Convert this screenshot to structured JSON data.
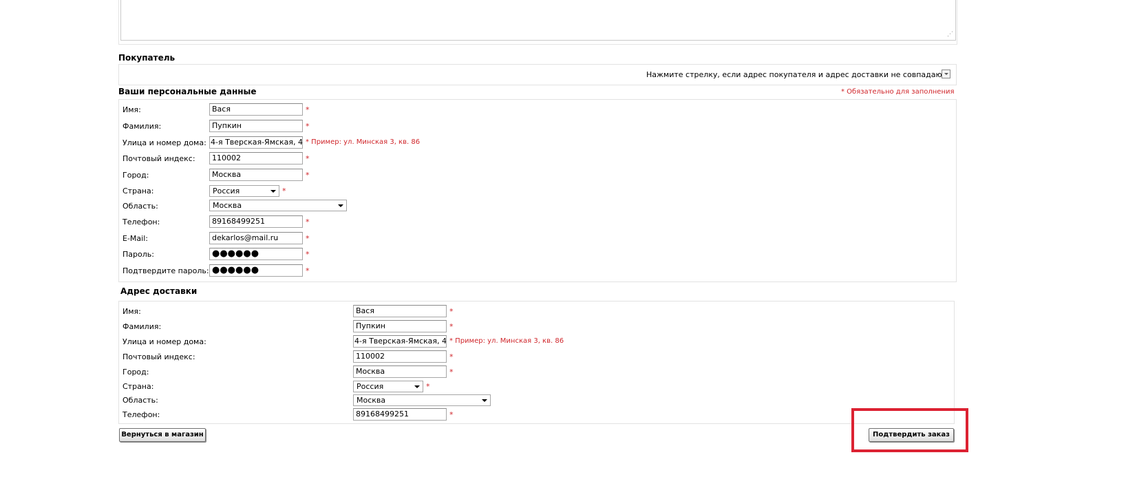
{
  "buyer": {
    "title": "Покупатель",
    "toggle_text": "Нажмите стрелку, если адрес покупателя и адрес доставки не совпадают:"
  },
  "personal": {
    "title": "Ваши персональные данные",
    "required_note": "* Обязательно для заполнения",
    "labels": {
      "first_name": "Имя:",
      "last_name": "Фамилия:",
      "street": "Улица и номер дома:",
      "zip": "Почтовый индекс:",
      "city": "Город:",
      "country": "Страна:",
      "region": "Область:",
      "phone": "Телефон:",
      "email": "E-Mail:",
      "password": "Пароль:",
      "password_confirm": "Подтвердите пароль:"
    },
    "values": {
      "first_name": "Вася",
      "last_name": "Пупкин",
      "street": "4-я Тверская-Ямская, 4",
      "zip": "110002",
      "city": "Москва",
      "country": "Россия",
      "region": "Москва",
      "phone": "89168499251",
      "email": "dekarlos@mail.ru",
      "password": "●●●●●●",
      "password_confirm": "●●●●●●"
    },
    "street_hint": "* Пример: ул. Минская 3, кв. 86",
    "req_mark": "*"
  },
  "shipping": {
    "title": "Адрес доставки",
    "labels": {
      "first_name": "Имя:",
      "last_name": "Фамилия:",
      "street": "Улица и номер дома:",
      "zip": "Почтовый индекс:",
      "city": "Город:",
      "country": "Страна:",
      "region": "Область:",
      "phone": "Телефон:"
    },
    "values": {
      "first_name": "Вася",
      "last_name": "Пупкин",
      "street": "4-я Тверская-Ямская, 4",
      "zip": "110002",
      "city": "Москва",
      "country": "Россия",
      "region": "Москва",
      "phone": "89168499251"
    },
    "street_hint": "* Пример: ул. Минская 3, кв. 86",
    "req_mark": "*"
  },
  "actions": {
    "back_label": "Вернуться в магазин",
    "confirm_label": "Подтвердить заказ"
  },
  "colors": {
    "required": "#d0262b",
    "highlight": "#dc2232"
  }
}
